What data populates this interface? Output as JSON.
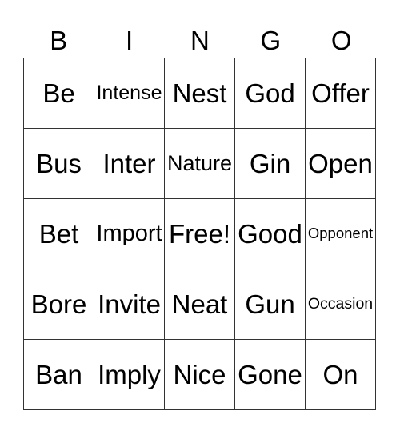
{
  "header": [
    "B",
    "I",
    "N",
    "G",
    "O"
  ],
  "rows": [
    [
      "Be",
      "Intense",
      "Nest",
      "God",
      "Offer"
    ],
    [
      "Bus",
      "Inter",
      "Nature",
      "Gin",
      "Open"
    ],
    [
      "Bet",
      "Import",
      "Free!",
      "Good",
      "Opponent"
    ],
    [
      "Bore",
      "Invite",
      "Neat",
      "Gun",
      "Occasion"
    ],
    [
      "Ban",
      "Imply",
      "Nice",
      "Gone",
      "On"
    ]
  ]
}
